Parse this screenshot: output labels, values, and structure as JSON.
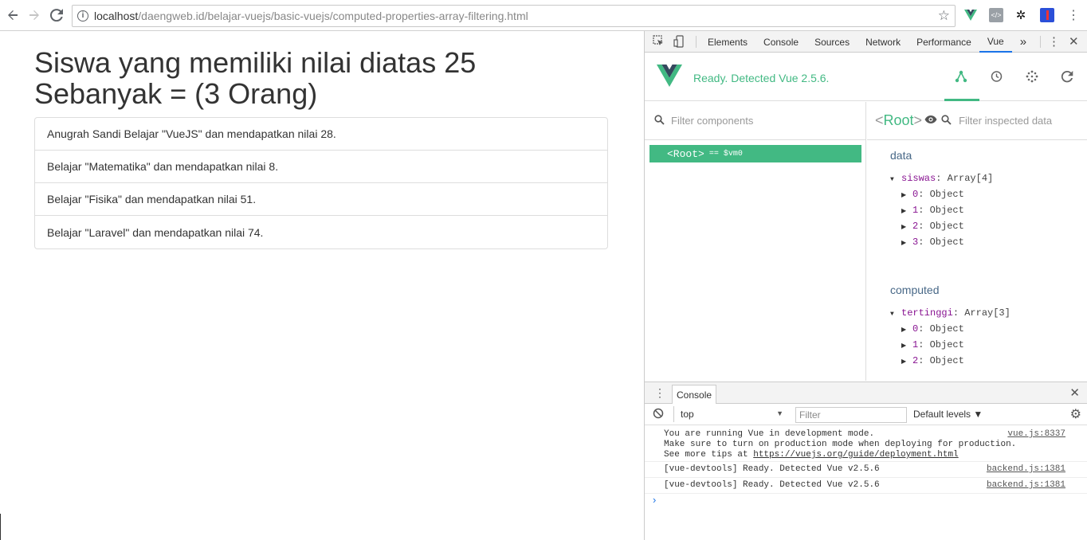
{
  "browser": {
    "url_host": "localhost",
    "url_path": "/daengweb.id/belajar-vuejs/basic-vuejs/computed-properties-array-filtering.html",
    "icons": [
      "back-icon",
      "forward-icon",
      "reload-icon",
      "info-icon",
      "star-icon"
    ]
  },
  "page": {
    "heading_line1": "Siswa yang memiliki nilai diatas 25",
    "heading_line2": "Sebanyak = (3 Orang)",
    "items": [
      "Anugrah Sandi Belajar \"VueJS\" dan mendapatkan nilai 28.",
      "Belajar \"Matematika\" dan mendapatkan nilai 8.",
      "Belajar \"Fisika\" dan mendapatkan nilai 51.",
      "Belajar \"Laravel\" dan mendapatkan nilai 74."
    ]
  },
  "devtools": {
    "tabs": [
      "Elements",
      "Console",
      "Sources",
      "Network",
      "Performance",
      "Vue"
    ],
    "more": "»",
    "vue": {
      "status": "Ready. Detected Vue 2.5.6.",
      "filter_components": "Filter components",
      "filter_inspected": "Filter inspected data",
      "root_label": "<Root>",
      "root_vm": "== $vm0",
      "root_tag": "Root",
      "data_title": "data",
      "computed_title": "computed",
      "data_key": "siswas",
      "data_type": "Array[4]",
      "computed_key": "tertinggi",
      "computed_type": "Array[3]",
      "object_label": "Object",
      "idx": [
        "0",
        "1",
        "2",
        "3"
      ]
    },
    "console": {
      "tab": "Console",
      "context": "top",
      "filter_placeholder": "Filter",
      "levels": "Default levels ▼",
      "msg1_l1": "You are running Vue in development mode.",
      "msg1_l2": "Make sure to turn on production mode when deploying for production.",
      "msg1_l3": "See more tips at ",
      "msg1_link": "https://vuejs.org/guide/deployment.html",
      "msg1_src": "vue.js:8337",
      "msg2": "[vue-devtools] Ready. Detected Vue v2.5.6",
      "msg2_src": "backend.js:1381",
      "msg3": "[vue-devtools] Ready. Detected Vue v2.5.6",
      "msg3_src": "backend.js:1381",
      "prompt": "›"
    }
  },
  "colors": {
    "vue_green": "#42b983",
    "text": "#333333",
    "link_blue": "#1a73e8"
  }
}
